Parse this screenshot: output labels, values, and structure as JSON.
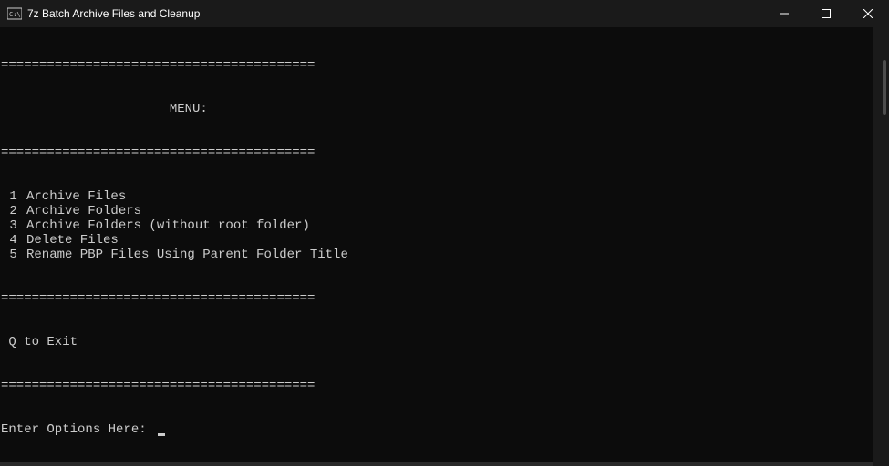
{
  "titlebar": {
    "title": "7z Batch Archive Files and Cleanup"
  },
  "console": {
    "separator": "=========================================",
    "menu_header": "                      MENU:",
    "menu_items": [
      {
        "num": " 1",
        "label": "Archive Files"
      },
      {
        "num": " 2",
        "label": "Archive Folders"
      },
      {
        "num": " 3",
        "label": "Archive Folders (without root folder)"
      },
      {
        "num": " 4",
        "label": "Delete Files"
      },
      {
        "num": " 5",
        "label": "Rename PBP Files Using Parent Folder Title"
      }
    ],
    "exit_line": " Q to Exit",
    "prompt": "Enter Options Here: "
  }
}
